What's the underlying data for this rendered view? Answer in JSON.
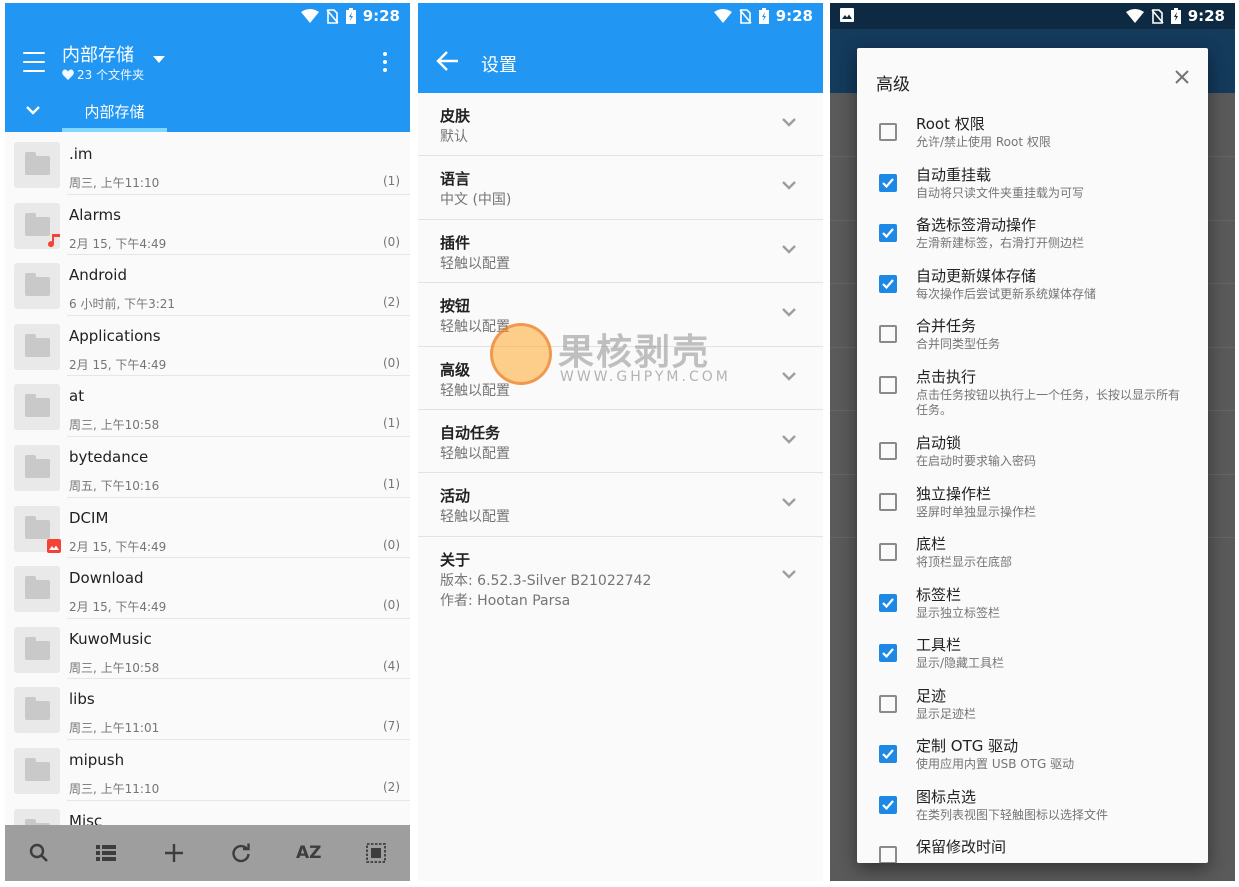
{
  "status": {
    "time": "9:28"
  },
  "file_browser": {
    "title": "内部存储",
    "subtitle": "23 个文件夹",
    "tab": "内部存储",
    "files": [
      {
        "name": ".im",
        "date": "周三, 上午11:10",
        "count": "(1)",
        "badge": ""
      },
      {
        "name": "Alarms",
        "date": "2月 15, 下午4:49",
        "count": "(0)",
        "badge": "music-note"
      },
      {
        "name": "Android",
        "date": "6 小时前, 下午3:21",
        "count": "(2)",
        "badge": ""
      },
      {
        "name": "Applications",
        "date": "2月 15, 下午4:49",
        "count": "(0)",
        "badge": ""
      },
      {
        "name": "at",
        "date": "周三, 上午10:58",
        "count": "(1)",
        "badge": ""
      },
      {
        "name": "bytedance",
        "date": "周五, 下午10:16",
        "count": "(1)",
        "badge": ""
      },
      {
        "name": "DCIM",
        "date": "2月 15, 下午4:49",
        "count": "(0)",
        "badge": "image"
      },
      {
        "name": "Download",
        "date": "2月 15, 下午4:49",
        "count": "(0)",
        "badge": ""
      },
      {
        "name": "KuwoMusic",
        "date": "周三, 上午10:58",
        "count": "(4)",
        "badge": ""
      },
      {
        "name": "libs",
        "date": "周三, 上午11:01",
        "count": "(7)",
        "badge": ""
      },
      {
        "name": "mipush",
        "date": "周三, 上午11:10",
        "count": "(2)",
        "badge": ""
      },
      {
        "name": "Misc",
        "date": "",
        "count": "",
        "badge": ""
      }
    ],
    "bottom_bar": {
      "icons": [
        "search-icon",
        "list-view-icon",
        "add-icon",
        "refresh-icon",
        "sort-az-icon",
        "select-all-icon"
      ],
      "sort_label": "AZ"
    }
  },
  "settings": {
    "title": "设置",
    "items": [
      {
        "title": "皮肤",
        "subtitle": "默认"
      },
      {
        "title": "语言",
        "subtitle": "中文 (中国)"
      },
      {
        "title": "插件",
        "subtitle": "轻触以配置"
      },
      {
        "title": "按钮",
        "subtitle": "轻触以配置"
      },
      {
        "title": "高级",
        "subtitle": "轻触以配置"
      },
      {
        "title": "自动任务",
        "subtitle": "轻触以配置"
      },
      {
        "title": "活动",
        "subtitle": "轻触以配置"
      }
    ],
    "about": {
      "title": "关于",
      "version": "版本: 6.52.3-Silver  B21022742",
      "author": "作者: Hootan Parsa"
    },
    "watermark": {
      "name": "果核剥壳",
      "url": "WWW.GHPYM.COM"
    }
  },
  "advanced_dialog": {
    "title": "高级",
    "options": [
      {
        "title": "Root 权限",
        "subtitle": "允许/禁止使用 Root 权限",
        "checked": false
      },
      {
        "title": "自动重挂载",
        "subtitle": "自动将只读文件夹重挂载为可写",
        "checked": true
      },
      {
        "title": "备选标签滑动操作",
        "subtitle": "左滑新建标签，右滑打开侧边栏",
        "checked": true
      },
      {
        "title": "自动更新媒体存储",
        "subtitle": "每次操作后尝试更新系统媒体存储",
        "checked": true
      },
      {
        "title": "合并任务",
        "subtitle": "合并同类型任务",
        "checked": false
      },
      {
        "title": "点击执行",
        "subtitle": "点击任务按钮以执行上一个任务，长按以显示所有任务。",
        "checked": false
      },
      {
        "title": "启动锁",
        "subtitle": "在启动时要求输入密码",
        "checked": false
      },
      {
        "title": "独立操作栏",
        "subtitle": "竖屏时单独显示操作栏",
        "checked": false
      },
      {
        "title": "底栏",
        "subtitle": "将顶栏显示在底部",
        "checked": false
      },
      {
        "title": "标签栏",
        "subtitle": "显示独立标签栏",
        "checked": true
      },
      {
        "title": "工具栏",
        "subtitle": "显示/隐藏工具栏",
        "checked": true
      },
      {
        "title": "足迹",
        "subtitle": "显示足迹栏",
        "checked": false
      },
      {
        "title": "定制 OTG 驱动",
        "subtitle": "使用应用内置 USB OTG 驱动",
        "checked": true
      },
      {
        "title": "图标点选",
        "subtitle": "在类列表视图下轻触图标以选择文件",
        "checked": true
      },
      {
        "title": "保留修改时间",
        "subtitle": "",
        "checked": false
      }
    ]
  },
  "colors": {
    "primary": "#2196f3",
    "accent": "#80d8ff",
    "checkbox": "#1e88e5"
  }
}
